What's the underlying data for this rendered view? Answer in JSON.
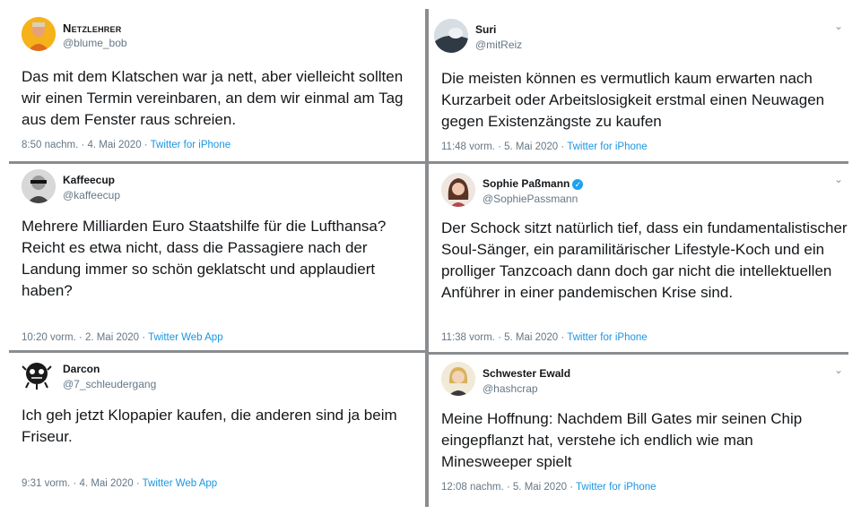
{
  "tweets": [
    {
      "name": "Netzlehrer",
      "handle": "@blume_bob",
      "text": "Das mit dem Klatschen war ja nett, aber vielleicht sollten wir einen Termin vereinbaren, an dem wir einmal am Tag aus dem Fenster raus schreien.",
      "time": "8:50 nachm. · 4. Mai 2020 · ",
      "source": "Twitter for iPhone"
    },
    {
      "name": "Suri",
      "handle": "@mitReiz",
      "text": "Die meisten können es vermutlich kaum erwarten nach Kurzarbeit oder Arbeitslosigkeit erstmal einen Neuwagen gegen Existenzängste zu kaufen",
      "time": "11:48 vorm. · 5. Mai 2020 · ",
      "source": "Twitter for iPhone"
    },
    {
      "name": "Kaffeecup",
      "handle": "@kaffeecup",
      "text": "Mehrere Milliarden Euro Staatshilfe für die Lufthansa? Reicht es etwa nicht, dass die Passagiere nach der Landung immer so schön geklatscht und applaudiert haben?",
      "time": "10:20 vorm. · 2. Mai 2020 · ",
      "source": "Twitter Web App"
    },
    {
      "name": "Sophie Paßmann",
      "handle": "@SophiePassmann",
      "text": "Der Schock sitzt natürlich tief, dass ein fundamentalistischer Soul-Sänger, ein paramilitärischer Lifestyle-Koch und ein prolliger Tanzcoach dann doch gar nicht die intellektuellen Anführer in einer pandemischen Krise sind.",
      "time": "11:38 vorm. · 5. Mai 2020 · ",
      "source": "Twitter for iPhone"
    },
    {
      "name": "Darcon",
      "handle": "@7_schleudergang",
      "text": "Ich geh jetzt Klopapier kaufen, die anderen sind ja beim Friseur.",
      "time": "9:31 vorm. · 4. Mai 2020 · ",
      "source": "Twitter Web App"
    },
    {
      "name": "Schwester Ewald",
      "handle": "@hashcrap",
      "text": "Meine Hoffnung: Nachdem Bill Gates mir seinen Chip eingepflanzt hat, verstehe ich endlich wie man Minesweeper spielt",
      "time": "12:08 nachm. · 5. Mai 2020 · ",
      "source": "Twitter for iPhone"
    }
  ],
  "icons": {
    "more": "chevron-down-icon",
    "verified": "verified-badge-icon"
  },
  "colors": {
    "link": "#1b95e0",
    "muted": "#657786",
    "divider": "#8a8d90"
  }
}
